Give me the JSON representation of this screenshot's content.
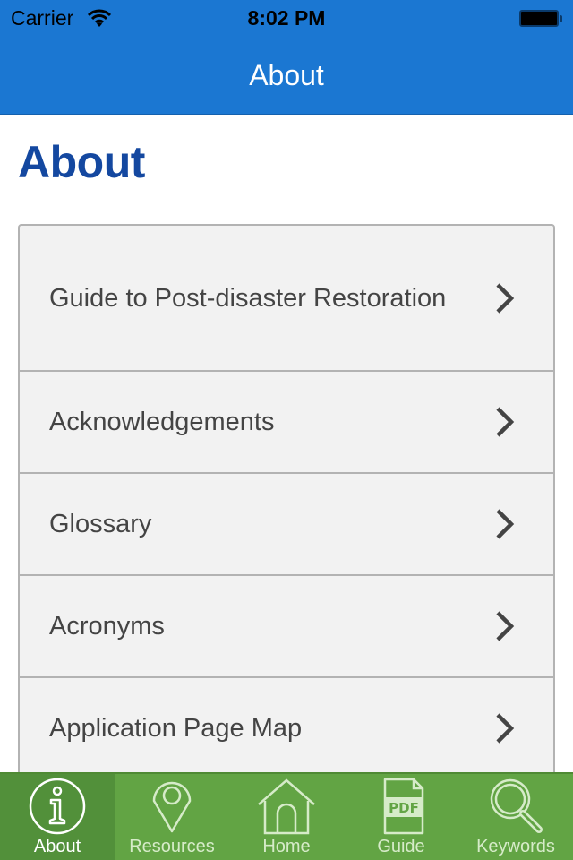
{
  "status_bar": {
    "carrier": "Carrier",
    "time": "8:02 PM",
    "battery_level": 1.0
  },
  "nav": {
    "title": "About"
  },
  "page": {
    "heading": "About"
  },
  "list": {
    "items": [
      {
        "label": "Guide to Post-disaster Restoration",
        "icon": "chevron-right-icon"
      },
      {
        "label": "Acknowledgements",
        "icon": "chevron-right-icon"
      },
      {
        "label": "Glossary",
        "icon": "chevron-right-icon"
      },
      {
        "label": "Acronyms",
        "icon": "chevron-right-icon"
      },
      {
        "label": "Application Page Map",
        "icon": "chevron-right-icon"
      }
    ]
  },
  "tabbar": {
    "active": "About",
    "tabs": [
      {
        "label": "About",
        "icon": "info-icon"
      },
      {
        "label": "Resources",
        "icon": "map-pin-icon"
      },
      {
        "label": "Home",
        "icon": "home-icon"
      },
      {
        "label": "Guide",
        "icon": "pdf-icon",
        "icon_text": "PDF"
      },
      {
        "label": "Keywords",
        "icon": "search-icon"
      }
    ]
  },
  "colors": {
    "nav_bar": "#1b77d2",
    "heading": "#1448a0",
    "list_bg": "#f2f2f2",
    "list_border": "#b3b3b3",
    "tab_bar": "#62a444",
    "tab_active": "#52903a"
  }
}
